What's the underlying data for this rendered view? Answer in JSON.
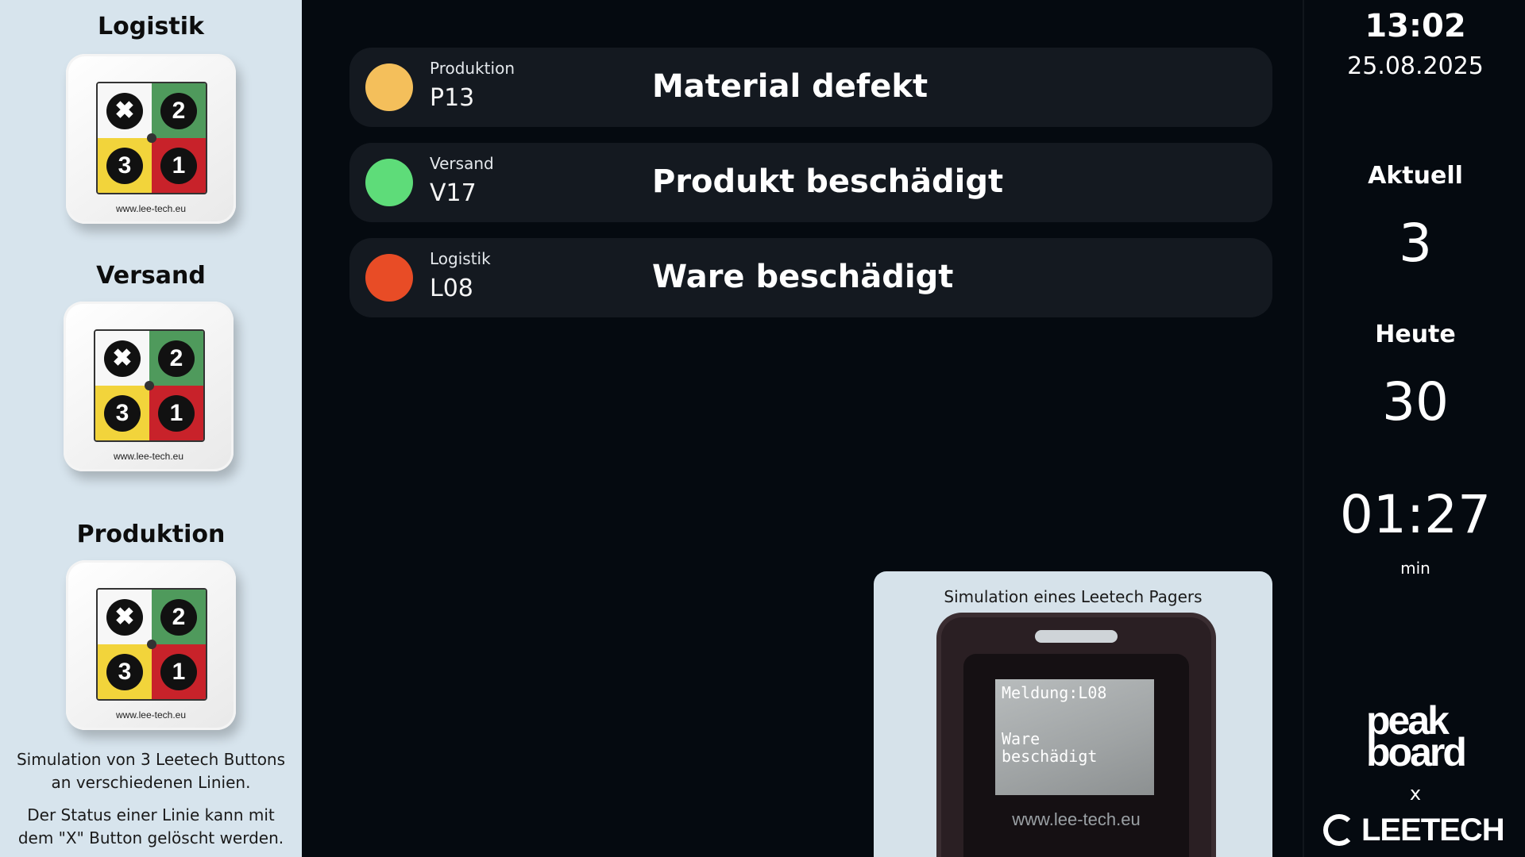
{
  "left_panel": {
    "stations": [
      {
        "title": "Logistik",
        "url": "www.lee-tech.eu"
      },
      {
        "title": "Versand",
        "url": "www.lee-tech.eu"
      },
      {
        "title": "Produktion",
        "url": "www.lee-tech.eu"
      }
    ],
    "button_keys": {
      "x": "✖",
      "two": "2",
      "three": "3",
      "one": "1"
    },
    "note_1": "Simulation von 3 Leetech Buttons an verschiedenen Linien.",
    "note_2": "Der Status einer Linie kann mit dem \"X\" Button gelöscht werden."
  },
  "alerts": [
    {
      "line": "Produktion",
      "code": "P13",
      "message": "Material defekt",
      "color": "#f4bf5b"
    },
    {
      "line": "Versand",
      "code": "V17",
      "message": "Produkt beschädigt",
      "color": "#5edc79"
    },
    {
      "line": "Logistik",
      "code": "L08",
      "message": "Ware beschädigt",
      "color": "#e84c26"
    }
  ],
  "pager": {
    "title": "Simulation eines Leetech Pagers",
    "screen_line1": "Meldung:L08",
    "screen_line2": "Ware",
    "screen_line3": "beschädigt",
    "url": "www.lee-tech.eu"
  },
  "right_panel": {
    "time": "13:02",
    "date": "25.08.2025",
    "current_label": "Aktuell",
    "current_value": "3",
    "today_label": "Heute",
    "today_value": "30",
    "duration_value": "01:27",
    "duration_unit": "min",
    "logo_peak_line1": "peak",
    "logo_peak_line2": "board",
    "separator": "x",
    "logo_leetech": "LEETECH"
  },
  "colors": {
    "background": "#050a10",
    "left_panel": "#d7e4ed",
    "row_bg": "#141920"
  }
}
